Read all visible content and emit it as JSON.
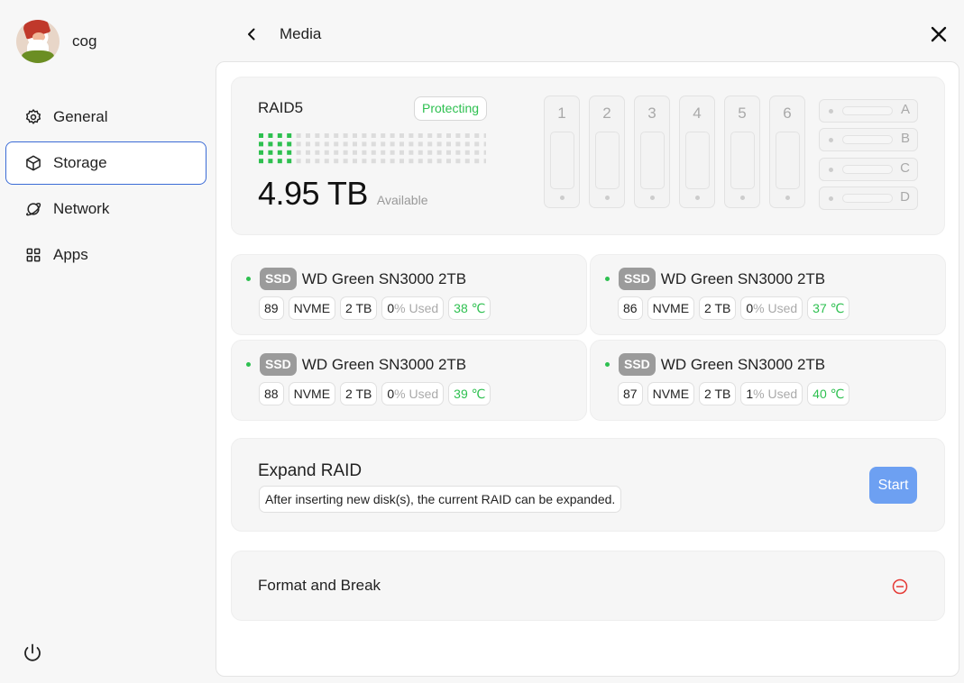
{
  "user": {
    "name": "cog"
  },
  "sidebar": {
    "items": [
      {
        "label": "General",
        "icon": "gear-icon"
      },
      {
        "label": "Storage",
        "icon": "box-icon",
        "active": true
      },
      {
        "label": "Network",
        "icon": "planet-icon"
      },
      {
        "label": "Apps",
        "icon": "apps-grid-icon"
      }
    ],
    "power_icon": "power-icon"
  },
  "header": {
    "title": "Media",
    "back_icon": "chevron-left-icon",
    "close_icon": "close-icon"
  },
  "raid": {
    "name": "RAID5",
    "status": "Protecting",
    "status_color": "#2ec050",
    "capacity": "4.95 TB",
    "capacity_label": "Available",
    "used_fraction": 0.167,
    "bays": [
      "1",
      "2",
      "3",
      "4",
      "5",
      "6"
    ],
    "m2_slots": [
      "A",
      "B",
      "C",
      "D"
    ]
  },
  "disks": [
    {
      "type": "SSD",
      "name": "WD Green SN3000 2TB",
      "health": "89",
      "interface": "NVME",
      "size": "2 TB",
      "used_value": "0",
      "used_label": "% Used",
      "temp": "38 ℃"
    },
    {
      "type": "SSD",
      "name": "WD Green SN3000 2TB",
      "health": "86",
      "interface": "NVME",
      "size": "2 TB",
      "used_value": "0",
      "used_label": "% Used",
      "temp": "37 ℃"
    },
    {
      "type": "SSD",
      "name": "WD Green SN3000 2TB",
      "health": "88",
      "interface": "NVME",
      "size": "2 TB",
      "used_value": "0",
      "used_label": "% Used",
      "temp": "39 ℃"
    },
    {
      "type": "SSD",
      "name": "WD Green SN3000 2TB",
      "health": "87",
      "interface": "NVME",
      "size": "2 TB",
      "used_value": "1",
      "used_label": "% Used",
      "temp": "40 ℃"
    }
  ],
  "expand": {
    "title": "Expand RAID",
    "description": "After inserting new disk(s), the current RAID can be expanded.",
    "button": "Start",
    "button_color": "#6da0f2"
  },
  "format": {
    "title": "Format and Break",
    "icon": "minus-circle-icon",
    "icon_color": "#e53935"
  }
}
